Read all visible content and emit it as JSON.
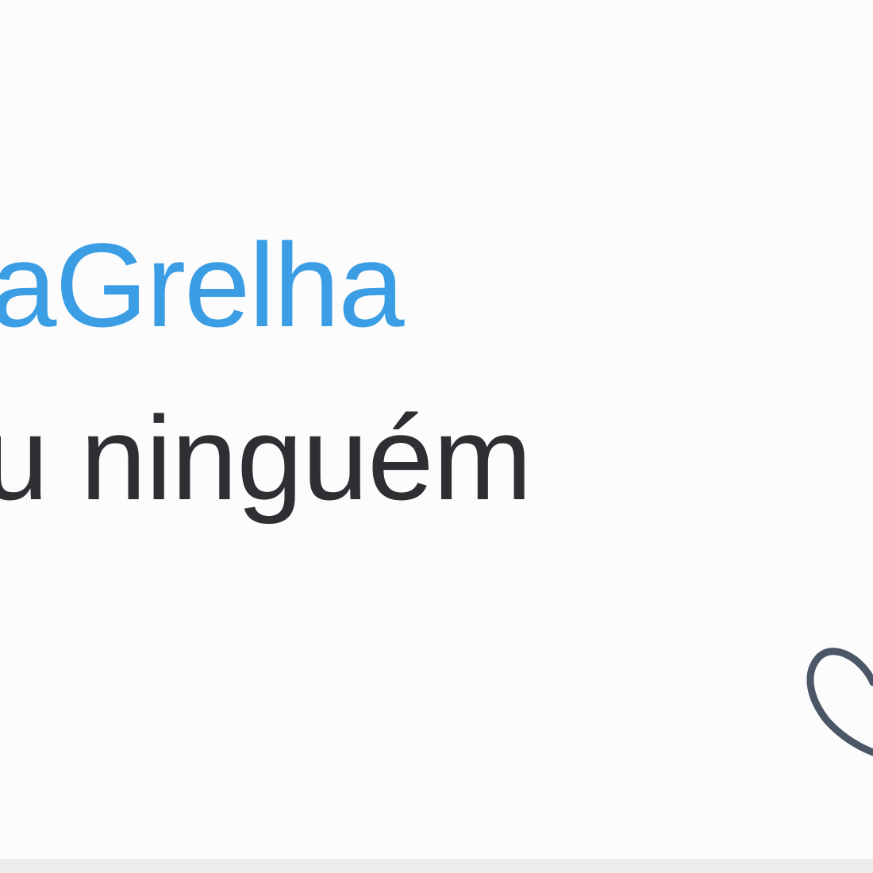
{
  "post": {
    "handle": "aGrelha",
    "text": "u ninguém",
    "handle_color": "#3b9ee4",
    "text_color": "#2d2f33"
  },
  "actions": {
    "like_icon": "heart-outline-icon",
    "icon_color": "#4b5666"
  }
}
